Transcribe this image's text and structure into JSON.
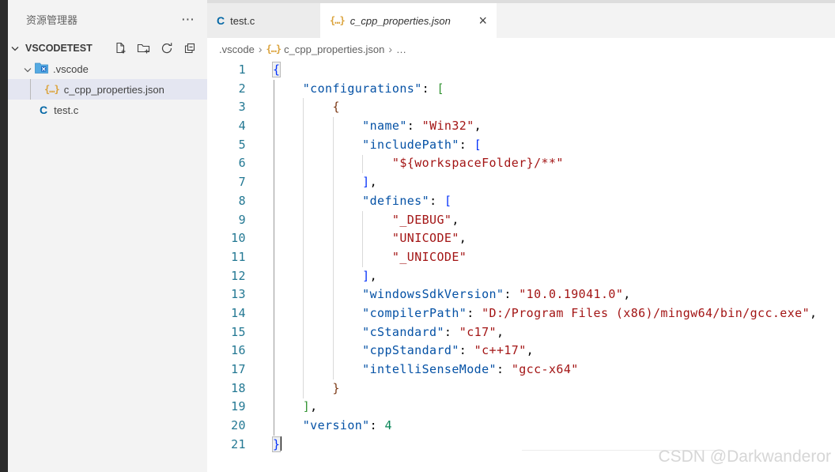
{
  "colors": {
    "activity_bar": "#2b2b2b",
    "sidebar_bg": "#f3f3f3",
    "selection_bg": "#e4e6f1",
    "tab_inactive_bg": "#ececec",
    "editor_bg": "#ffffff",
    "line_number": "#237893",
    "json_key": "#0451a5",
    "json_string": "#a31515",
    "json_number": "#098658",
    "bracket_level1": "#0431fa",
    "bracket_level2": "#319331",
    "bracket_level3": "#7b3814",
    "json_icon": "#dba33c",
    "c_icon": "#0568a6"
  },
  "sidebar": {
    "header": {
      "title": "资源管理器",
      "more_label": "⋯",
      "more_icon": "more-actions-icon"
    },
    "section": {
      "name": "VSCODETEST",
      "actions": [
        "new-file-icon",
        "new-folder-icon",
        "refresh-icon",
        "collapse-all-icon"
      ]
    },
    "tree": [
      {
        "label": ".vscode",
        "type": "folder",
        "icon": "vscode-folder-icon",
        "expanded": true,
        "selected": false
      },
      {
        "label": "c_cpp_properties.json",
        "type": "json",
        "icon": "json-file-icon",
        "selected": true
      },
      {
        "label": "test.c",
        "type": "c",
        "icon": "c-file-icon",
        "selected": false
      }
    ]
  },
  "tabs": [
    {
      "label": "test.c",
      "icon": "c-file-icon",
      "active": false
    },
    {
      "label": "c_cpp_properties.json",
      "icon": "json-file-icon",
      "active": true,
      "preview": true,
      "close_label": "×"
    }
  ],
  "breadcrumb": {
    "separator": "›",
    "items": [
      ".vscode",
      "c_cpp_properties.json",
      "…"
    ],
    "item1_icon": "json-file-icon"
  },
  "editor": {
    "language": "json",
    "cursor_line": 21,
    "lines": [
      {
        "num": 1,
        "segs": [
          [
            "b1m",
            "{"
          ]
        ]
      },
      {
        "num": 2,
        "segs": [
          [
            "pun",
            "    "
          ],
          [
            "key",
            "\"configurations\""
          ],
          [
            "pun",
            ": "
          ],
          [
            "b2",
            "["
          ]
        ]
      },
      {
        "num": 3,
        "segs": [
          [
            "pun",
            "        "
          ],
          [
            "b3",
            "{"
          ]
        ]
      },
      {
        "num": 4,
        "segs": [
          [
            "pun",
            "            "
          ],
          [
            "key",
            "\"name\""
          ],
          [
            "pun",
            ": "
          ],
          [
            "str",
            "\"Win32\""
          ],
          [
            "pun",
            ","
          ]
        ]
      },
      {
        "num": 5,
        "segs": [
          [
            "pun",
            "            "
          ],
          [
            "key",
            "\"includePath\""
          ],
          [
            "pun",
            ": "
          ],
          [
            "b1",
            "["
          ]
        ]
      },
      {
        "num": 6,
        "segs": [
          [
            "pun",
            "                "
          ],
          [
            "str",
            "\"${workspaceFolder}/**\""
          ]
        ]
      },
      {
        "num": 7,
        "segs": [
          [
            "pun",
            "            "
          ],
          [
            "b1",
            "]"
          ],
          [
            "pun",
            ","
          ]
        ]
      },
      {
        "num": 8,
        "segs": [
          [
            "pun",
            "            "
          ],
          [
            "key",
            "\"defines\""
          ],
          [
            "pun",
            ": "
          ],
          [
            "b1",
            "["
          ]
        ]
      },
      {
        "num": 9,
        "segs": [
          [
            "pun",
            "                "
          ],
          [
            "str",
            "\"_DEBUG\""
          ],
          [
            "pun",
            ","
          ]
        ]
      },
      {
        "num": 10,
        "segs": [
          [
            "pun",
            "                "
          ],
          [
            "str",
            "\"UNICODE\""
          ],
          [
            "pun",
            ","
          ]
        ]
      },
      {
        "num": 11,
        "segs": [
          [
            "pun",
            "                "
          ],
          [
            "str",
            "\"_UNICODE\""
          ]
        ]
      },
      {
        "num": 12,
        "segs": [
          [
            "pun",
            "            "
          ],
          [
            "b1",
            "]"
          ],
          [
            "pun",
            ","
          ]
        ]
      },
      {
        "num": 13,
        "segs": [
          [
            "pun",
            "            "
          ],
          [
            "key",
            "\"windowsSdkVersion\""
          ],
          [
            "pun",
            ": "
          ],
          [
            "str",
            "\"10.0.19041.0\""
          ],
          [
            "pun",
            ","
          ]
        ]
      },
      {
        "num": 14,
        "segs": [
          [
            "pun",
            "            "
          ],
          [
            "key",
            "\"compilerPath\""
          ],
          [
            "pun",
            ": "
          ],
          [
            "str",
            "\"D:/Program Files (x86)/mingw64/bin/gcc.exe\""
          ],
          [
            "pun",
            ","
          ]
        ]
      },
      {
        "num": 15,
        "segs": [
          [
            "pun",
            "            "
          ],
          [
            "key",
            "\"cStandard\""
          ],
          [
            "pun",
            ": "
          ],
          [
            "str",
            "\"c17\""
          ],
          [
            "pun",
            ","
          ]
        ]
      },
      {
        "num": 16,
        "segs": [
          [
            "pun",
            "            "
          ],
          [
            "key",
            "\"cppStandard\""
          ],
          [
            "pun",
            ": "
          ],
          [
            "str",
            "\"c++17\""
          ],
          [
            "pun",
            ","
          ]
        ]
      },
      {
        "num": 17,
        "segs": [
          [
            "pun",
            "            "
          ],
          [
            "key",
            "\"intelliSenseMode\""
          ],
          [
            "pun",
            ": "
          ],
          [
            "str",
            "\"gcc-x64\""
          ]
        ]
      },
      {
        "num": 18,
        "segs": [
          [
            "pun",
            "        "
          ],
          [
            "b3",
            "}"
          ]
        ]
      },
      {
        "num": 19,
        "segs": [
          [
            "pun",
            "    "
          ],
          [
            "b2",
            "]"
          ],
          [
            "pun",
            ","
          ]
        ]
      },
      {
        "num": 20,
        "segs": [
          [
            "pun",
            "    "
          ],
          [
            "key",
            "\"version\""
          ],
          [
            "pun",
            ": "
          ],
          [
            "num",
            "4"
          ]
        ]
      },
      {
        "num": 21,
        "segs": [
          [
            "b1m",
            "}"
          ]
        ]
      }
    ]
  },
  "watermark": {
    "text": "CSDN @Darkwanderor"
  },
  "icons_text": {
    "json_glyph": "{…}",
    "c_glyph": "C"
  }
}
